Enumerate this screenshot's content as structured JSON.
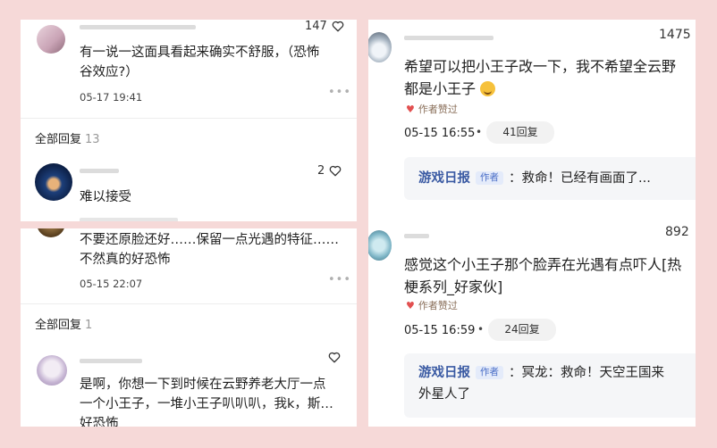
{
  "top_left": {
    "comment": {
      "likes": "147",
      "text_line1": "有一说一这面具看起来确实不舒服，（恐怖",
      "text_line2": "谷效应?）",
      "time": "05-17 19:41"
    },
    "all_replies_label": "全部回复",
    "all_replies_count": "13",
    "reply": {
      "likes": "2",
      "text": "难以接受"
    }
  },
  "bottom_left": {
    "comment": {
      "text_line1": "不要还原脸还好……保留一点光遇的特征……",
      "text_line2": "不然真的好恐怖",
      "time": "05-15 22:07"
    },
    "all_replies_label": "全部回复",
    "all_replies_count": "1",
    "reply": {
      "text_line1": "是啊，你想一下到时候在云野养老大厅一点",
      "text_line2": "一个小王子，一堆小王子叭叭叭，我k，斯…",
      "text_line3": "好恐怖"
    }
  },
  "right": {
    "comment1": {
      "likes": "1475",
      "text_line1": "希望可以把小王子改一下，我不希望全云野",
      "text_line2": "都是小王子",
      "author_liked": "作者赞过",
      "time": "05-15 16:55",
      "reply_count": "41回复",
      "quote_source": "游戏日报",
      "quote_tag": "作者",
      "quote_text": "救命！已经有画面了..."
    },
    "comment2": {
      "likes": "892",
      "text_line1": "感觉这个小王子那个脸弄在光遇有点吓人[热",
      "text_line2": "梗系列_好家伙]",
      "author_liked": "作者赞过",
      "time": "05-15 16:59",
      "reply_count": "24回复",
      "quote_source": "游戏日报",
      "quote_tag": "作者",
      "quote_text_line1": "冥龙：救命！天空王国来",
      "quote_text_line2": "外星人了"
    }
  },
  "colors": {
    "background": "#f6d9d8",
    "link_blue": "#3a5aa3",
    "heart_red": "#e25050"
  },
  "icons": [
    "heart-outline-icon",
    "more-dots-icon",
    "heart-filled-icon",
    "grinning-emoji-icon"
  ]
}
